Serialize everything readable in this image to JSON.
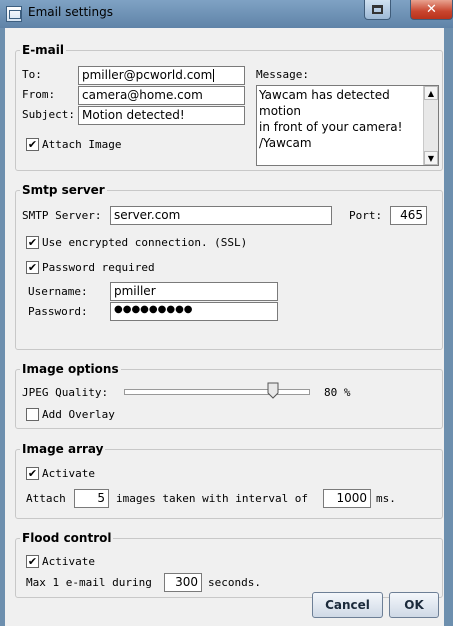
{
  "window": {
    "title": "Email settings",
    "close_glyph": "✕",
    "restore_icon": "restore-window-icon"
  },
  "email": {
    "title": "E-mail",
    "to_label": "To:",
    "to_value": "pmiller@pcworld.com",
    "from_label": "From:",
    "from_value": "camera@home.com",
    "subject_label": "Subject:",
    "subject_value": "Motion detected!",
    "attach_image_label": "Attach Image",
    "attach_image_checked": true,
    "message_label": "Message:",
    "message_lines": [
      "Yawcam has detected motion",
      "in front of your camera!",
      "/Yawcam"
    ]
  },
  "smtp": {
    "title": "Smtp server",
    "server_label": "SMTP Server:",
    "server_value": "server.com",
    "port_label": "Port:",
    "port_value": "465",
    "ssl_label": "Use encrypted connection. (SSL)",
    "ssl_checked": true,
    "password_required_label": "Password required",
    "password_required_checked": true,
    "username_label": "Username:",
    "username_value": "pmiller",
    "password_label": "Password:",
    "password_value": "●●●●●●●●●"
  },
  "image_options": {
    "title": "Image options",
    "jpeg_quality_label": "JPEG Quality:",
    "jpeg_quality_percent": 80,
    "jpeg_quality_text": "80 %",
    "add_overlay_label": "Add Overlay",
    "add_overlay_checked": false
  },
  "image_array": {
    "title": "Image array",
    "activate_label": "Activate",
    "activate_checked": true,
    "attach_label": "Attach",
    "images_count": "5",
    "interval_label": "images taken with interval of",
    "interval_value": "1000",
    "ms_label": "ms."
  },
  "flood_control": {
    "title": "Flood control",
    "activate_label": "Activate",
    "activate_checked": true,
    "max_label": "Max 1 e-mail during",
    "seconds_value": "300",
    "seconds_label": "seconds."
  },
  "buttons": {
    "cancel": "Cancel",
    "ok": "OK"
  },
  "checkmark_glyph": "✔",
  "colors": {
    "titlebar": "#6d8fae",
    "close_button": "#c8452e"
  }
}
